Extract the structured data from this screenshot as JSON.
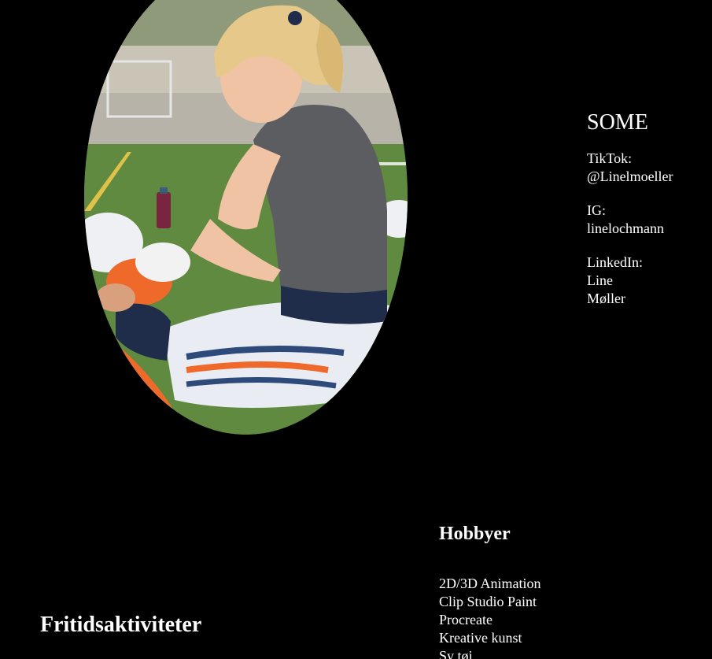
{
  "photo": {
    "subject": "player-taping-hands-photo"
  },
  "some": {
    "title": "SOME",
    "tiktok": {
      "label": "TikTok:",
      "value": "@Linelmoeller"
    },
    "instagram": {
      "label": "IG:",
      "value": "linelochmann"
    },
    "linkedin": {
      "label": "LinkedIn:",
      "value_line1": "Line",
      "value_line2": "Møller"
    }
  },
  "hobbies": {
    "title": "Hobbyer",
    "items": [
      "2D/3D Animation",
      "Clip Studio Paint",
      "Procreate",
      "Kreative kunst",
      "Sy tøj"
    ]
  },
  "leisure": {
    "title": "Fritidsaktiviteter"
  },
  "colors": {
    "background": "#000000",
    "text": "#ffffff",
    "turf": "#5f8a3f",
    "jersey": "#5b5d60",
    "pants": "#e9ecf2",
    "stripe_orange": "#ef6a2a",
    "stripe_navy": "#2d4a7a"
  }
}
